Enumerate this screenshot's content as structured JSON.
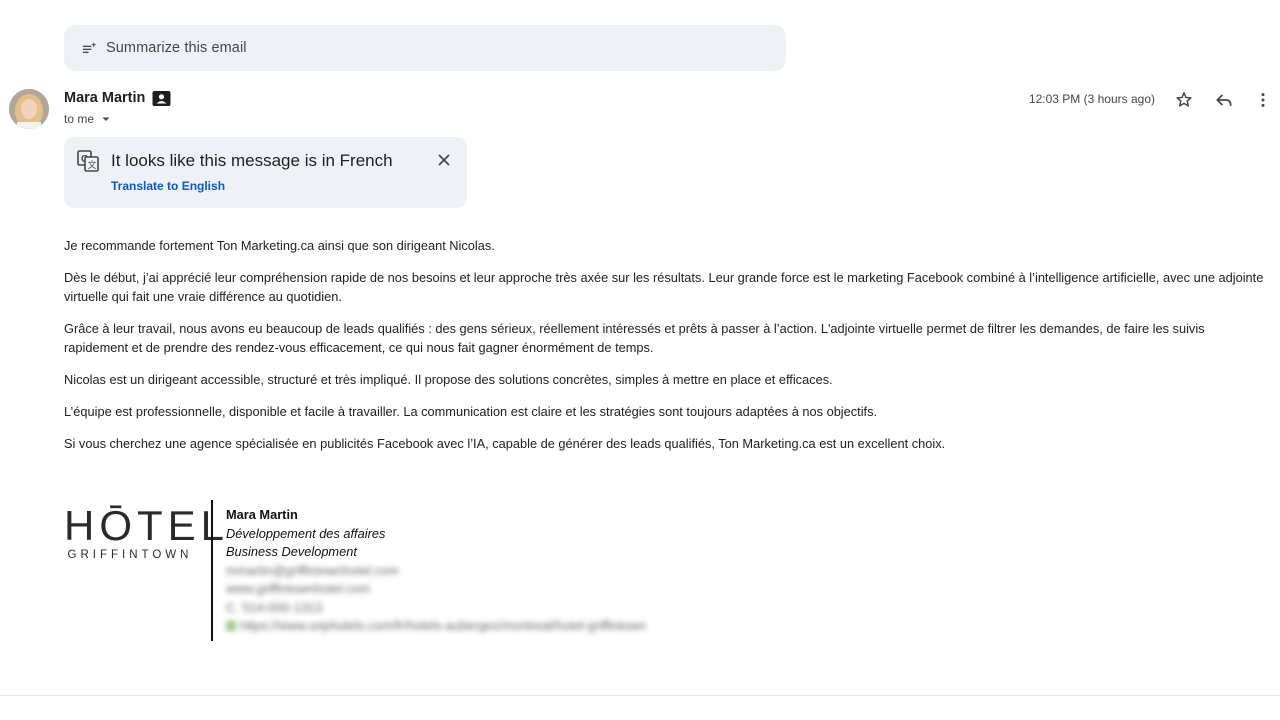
{
  "summarize": {
    "label": "Summarize this email"
  },
  "sender": {
    "name": "Mara Martin",
    "recipient_label": "to me"
  },
  "header": {
    "timestamp": "12:03 PM (3 hours ago)",
    "icons": [
      "star-icon",
      "reply-icon",
      "more-vert-icon"
    ]
  },
  "translate": {
    "title": "It looks like this message is in French",
    "link": "Translate to English"
  },
  "body": {
    "paragraphs": [
      "Je recommande fortement Ton Marketing.ca ainsi que son dirigeant Nicolas.",
      "Dès le début, j’ai apprécié leur compréhension rapide de nos besoins et leur approche très axée sur les résultats. Leur grande force est le marketing Facebook combiné à l’intelligence artificielle, avec une adjointe virtuelle qui fait une vraie différence au quotidien.",
      "Grâce à leur travail, nous avons eu beaucoup de leads qualifiés : des gens sérieux, réellement intéressés et prêts à passer à l’action. L'adjointe virtuelle permet de filtrer les demandes, de faire les suivis rapidement et de prendre des rendez-vous efficacement, ce qui nous fait gagner énormément de temps.",
      "Nicolas est un dirigeant accessible, structuré et très impliqué. Il propose des solutions concrètes, simples à mettre en place et efficaces.",
      "L’équipe est professionnelle, disponible et facile à travailler. La communication est claire et les stratégies sont toujours adaptées à nos objectifs.",
      "Si vous cherchez une agence spécialisée en publicités Facebook avec l’IA, capable de générer des leads qualifiés, Ton Marketing.ca est un excellent choix."
    ]
  },
  "signature": {
    "logo_main": "HŌTEL",
    "logo_sub": "GRIFFINTOWN",
    "name": "Mara Martin",
    "role_fr": "Développement des affaires",
    "role_en": "Business Development",
    "email_blurred": "mmartin@griffintownhotel.com",
    "website_blurred": "www.griffintownhotel.com",
    "phone_blurred": "C. 514-000-1313",
    "image_link_blurred": "https://www.oriphotels.com/fr/hotels-auberges/montreal/hotel-griffintown"
  }
}
